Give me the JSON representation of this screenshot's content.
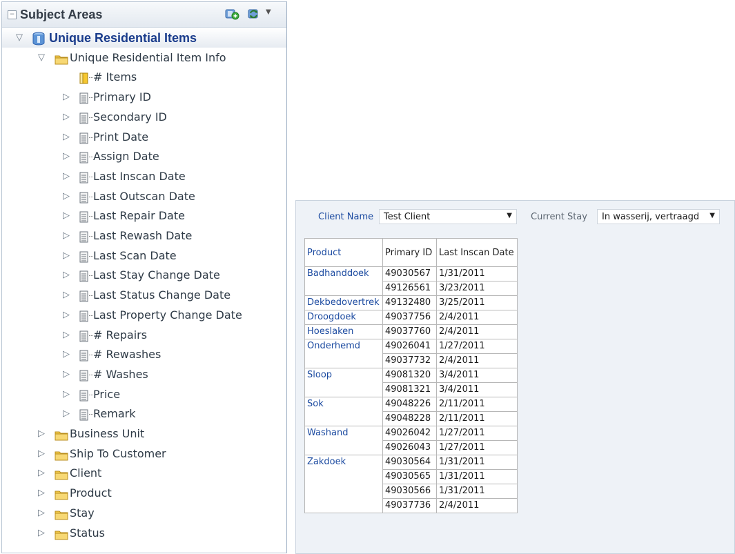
{
  "subject_areas": {
    "title": "Subject Areas",
    "root": {
      "label": "Unique Residential Items",
      "folder": {
        "label": "Unique Residential Item Info",
        "measure": "# Items",
        "columns": [
          "Primary ID",
          "Secondary ID",
          "Print Date",
          "Assign Date",
          "Last Inscan Date",
          "Last Outscan Date",
          "Last Repair Date",
          "Last Rewash Date",
          "Last Scan Date",
          "Last Stay Change Date",
          "Last Status Change Date",
          "Last Property Change Date",
          "# Repairs",
          "# Rewashes",
          "# Washes",
          "Price",
          "Remark"
        ]
      },
      "other_folders": [
        "Business Unit",
        "Ship To Customer",
        "Client",
        "Product",
        "Stay",
        "Status"
      ]
    }
  },
  "report": {
    "client_name_label": "Client Name",
    "client_name_value": "Test Client",
    "current_stay_label": "Current Stay",
    "current_stay_value": "In wasserij, vertraagd",
    "table": {
      "headers": [
        "Product",
        "Primary ID",
        "Last Inscan Date"
      ],
      "groups": [
        {
          "product": "Badhanddoek",
          "rows": [
            [
              "49030567",
              "1/31/2011"
            ],
            [
              "49126561",
              "3/23/2011"
            ]
          ]
        },
        {
          "product": "Dekbedovertrek",
          "rows": [
            [
              "49132480",
              "3/25/2011"
            ]
          ]
        },
        {
          "product": "Droogdoek",
          "rows": [
            [
              "49037756",
              "2/4/2011"
            ]
          ]
        },
        {
          "product": "Hoeslaken",
          "rows": [
            [
              "49037760",
              "2/4/2011"
            ]
          ]
        },
        {
          "product": "Onderhemd",
          "rows": [
            [
              "49026041",
              "1/27/2011"
            ],
            [
              "49037732",
              "2/4/2011"
            ]
          ]
        },
        {
          "product": "Sloop",
          "rows": [
            [
              "49081320",
              "3/4/2011"
            ],
            [
              "49081321",
              "3/4/2011"
            ]
          ]
        },
        {
          "product": "Sok",
          "rows": [
            [
              "49048226",
              "2/11/2011"
            ],
            [
              "49048228",
              "2/11/2011"
            ]
          ]
        },
        {
          "product": "Washand",
          "rows": [
            [
              "49026042",
              "1/27/2011"
            ],
            [
              "49026043",
              "1/27/2011"
            ]
          ]
        },
        {
          "product": "Zakdoek",
          "rows": [
            [
              "49030564",
              "1/31/2011"
            ],
            [
              "49030565",
              "1/31/2011"
            ],
            [
              "49030566",
              "1/31/2011"
            ],
            [
              "49037736",
              "2/4/2011"
            ]
          ]
        }
      ]
    }
  },
  "icons": {
    "collapse": "collapse-panel-icon",
    "add": "add-subject-area-icon",
    "refresh": "refresh-icon",
    "subject_area": "subject-area-cube-icon",
    "folder": "folder-icon",
    "measure": "measure-column-icon",
    "column": "attribute-column-icon"
  },
  "colors": {
    "link_blue": "#1b4aa0",
    "folder_yellow": "#f2c94c",
    "report_bg": "#eef2f7"
  }
}
